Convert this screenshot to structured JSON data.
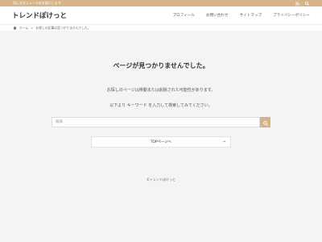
{
  "topbar": {
    "text": "気になるニュースをお届けします",
    "color": "#d7b488"
  },
  "header": {
    "site_title": "トレンドぽけっと",
    "nav": [
      {
        "label": "プロフィール"
      },
      {
        "label": "お問い合わせ"
      },
      {
        "label": "サイトマップ"
      },
      {
        "label": "プライバシーポリシー"
      }
    ]
  },
  "breadcrumb": {
    "home": "ホーム",
    "separator": ">",
    "current": "お探しの記事は見つかりませんでした。"
  },
  "main": {
    "title": "ページが見つかりませんでした。",
    "message1": "お探しのページは移動または削除された可能性があります。",
    "message2": "以下より キーワード を入力して検索してみてください。",
    "search": {
      "placeholder": "検索",
      "button_icon": "search-icon"
    },
    "top_page_button": {
      "label": "TOPページへ",
      "arrow": "→"
    }
  },
  "footer": {
    "copyright": "©トレンドぽけっと"
  }
}
